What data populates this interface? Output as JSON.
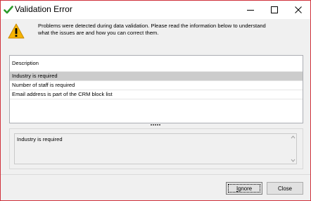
{
  "window": {
    "title": "Validation Error",
    "controls": [
      "minimize-icon",
      "maximize-icon",
      "close-icon"
    ]
  },
  "message": {
    "line1": "Problems were detected during data validation. Please read the information below to understand",
    "line2": "what the issues are and how you can correct them.",
    "icon": "warning-icon"
  },
  "list": {
    "header": "Description",
    "rows": [
      "Industry is required",
      "Number of staff is required",
      "Email address is part of the CRM block list"
    ],
    "selected_index": 0
  },
  "detail": {
    "text": "Industry is required"
  },
  "buttons": {
    "ignore_prefix": "",
    "ignore_underlined": "I",
    "ignore_rest": "gnore",
    "close": "Close"
  },
  "colors": {
    "window_border": "#d0323c",
    "selected_row": "#cccccc",
    "warning": "#f5b300",
    "checkmark": "#2a9a2a"
  }
}
